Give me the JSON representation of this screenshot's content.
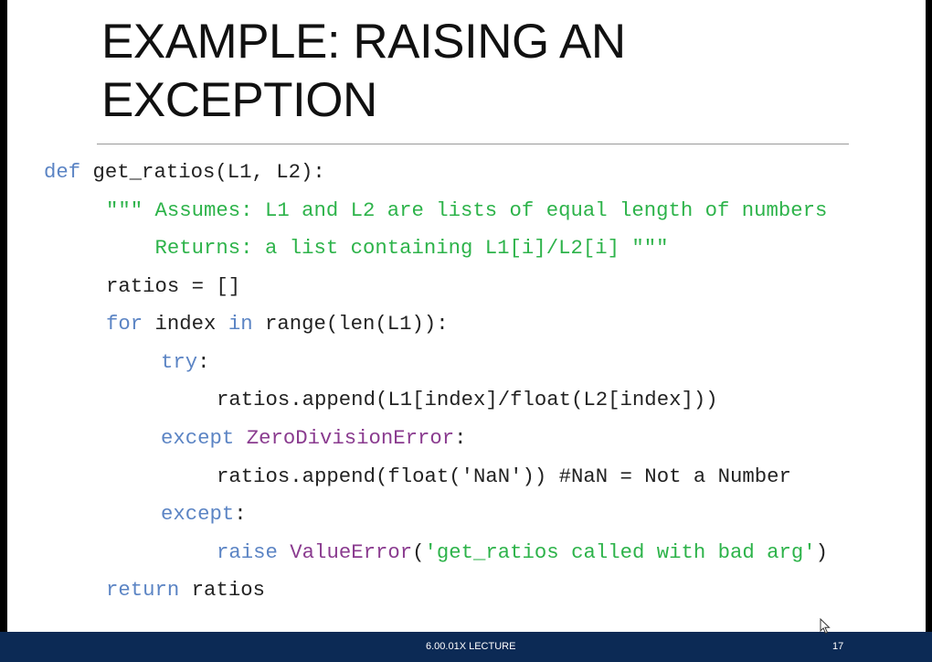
{
  "slide": {
    "title_line1": "EXAMPLE: RAISING AN",
    "title_line2": "EXCEPTION"
  },
  "code": {
    "l1_kw": "def",
    "l1_rest": " get_ratios(L1, L2):",
    "l2_str": "\"\"\" Assumes: L1 and L2 are lists of equal length of numbers",
    "l3_str": "    Returns: a list containing L1[i]/L2[i] \"\"\"",
    "l4": "ratios = []",
    "l5_kw1": "for",
    "l5_a": " index ",
    "l5_kw2": "in",
    "l5_b": " range(len(L1)):",
    "l6_kw": "try",
    "l6_rest": ":",
    "l7": "ratios.append(L1[index]/float(L2[index]))",
    "l8_kw": "except",
    "l8_sp": " ",
    "l8_cls": "ZeroDivisionError",
    "l8_rest": ":",
    "l9": "ratios.append(float('NaN')) #NaN = Not a Number",
    "l10_kw": "except",
    "l10_rest": ":",
    "l11_kw": "raise",
    "l11_sp": " ",
    "l11_cls": "ValueError",
    "l11_open": "(",
    "l11_str": "'get_ratios called with bad arg'",
    "l11_close": ")",
    "l12_kw": "return",
    "l12_rest": " ratios"
  },
  "footer": {
    "label": "6.00.01X LECTURE",
    "page": "17"
  },
  "colors": {
    "keyword": "#5b84c4",
    "string": "#2db34a",
    "class": "#8a3b8f",
    "footer_bg": "#0c2a55"
  }
}
